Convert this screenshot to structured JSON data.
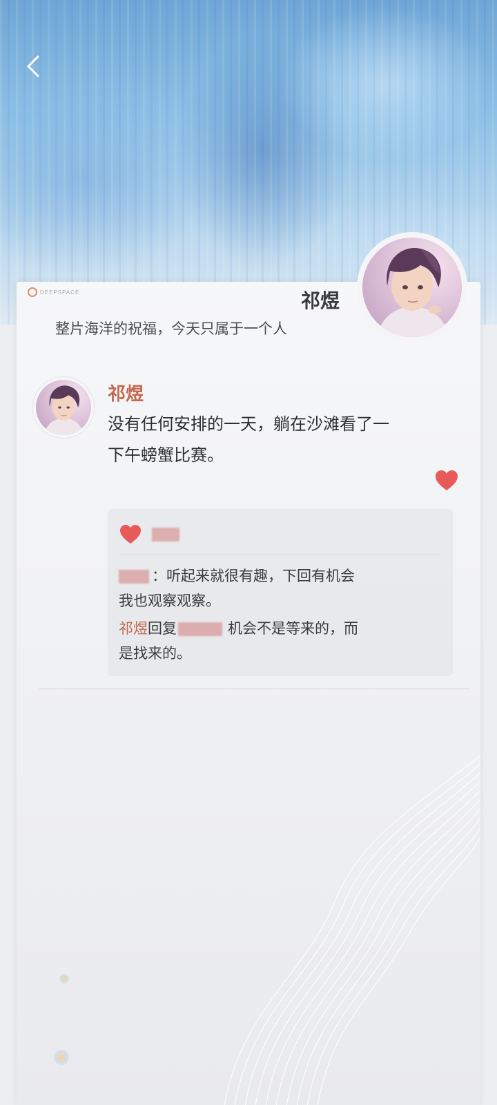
{
  "header": {
    "back_label": "‹",
    "logo_text": "DEEPSPACE",
    "character_name": "祁煜",
    "tagline": "整片海洋的祝福，今天只属于一个人"
  },
  "post": {
    "author": "祁煜",
    "text_line1": "没有任何安排的一天，躺在沙滩看了一",
    "text_line2": "下午螃蟹比赛。",
    "liked": true
  },
  "comments": {
    "comment1_prefix": "：听起来就很有趣，下回有机会",
    "comment1_line2": "我也观察观察。",
    "reply_author": "祁煜",
    "reply_word": "回复",
    "reply_text": "机会不是等来的，而",
    "reply_line2": "是找来的。"
  },
  "colors": {
    "accent": "#c4694f",
    "heart": "#e85a5a"
  }
}
